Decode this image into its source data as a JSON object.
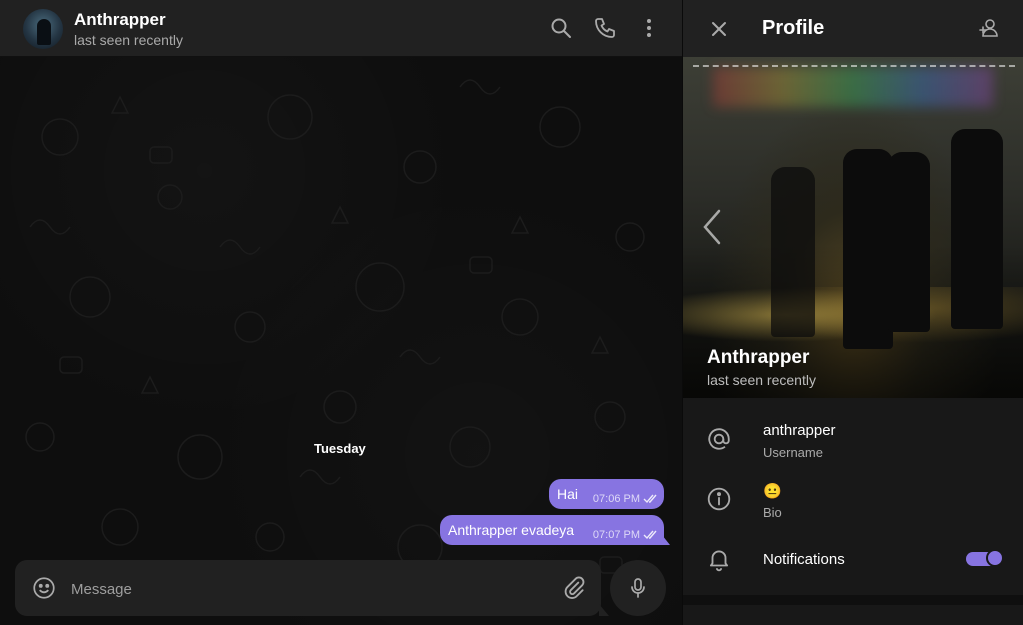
{
  "chat": {
    "title": "Anthrapper",
    "status": "last seen recently",
    "date_label": "Tuesday",
    "messages": [
      {
        "text": "Hai",
        "time": "07:06 PM",
        "outgoing": true,
        "read": true
      },
      {
        "text": "Anthrapper evadeya",
        "time": "07:07 PM",
        "outgoing": true,
        "read": true
      }
    ],
    "composer": {
      "placeholder": "Message"
    },
    "icons": {
      "search": "search-icon",
      "call": "phone-icon",
      "more": "more-vertical-icon",
      "emoji": "smile-icon",
      "attach": "paperclip-icon",
      "mic": "microphone-icon"
    }
  },
  "profile": {
    "header_title": "Profile",
    "name": "Anthrapper",
    "status": "last seen recently",
    "rows": {
      "username": {
        "value": "anthrapper",
        "label": "Username"
      },
      "bio": {
        "value": "😐",
        "label": "Bio"
      },
      "notifications": {
        "label": "Notifications",
        "enabled": true
      }
    },
    "icons": {
      "close": "close-icon",
      "add_contact": "add-contact-icon",
      "prev_photo": "chevron-left-icon",
      "at": "at-icon",
      "info": "info-icon",
      "bell": "bell-icon"
    }
  },
  "colors": {
    "accent": "#8774e1",
    "background": "#0e0e0e",
    "panel": "#212121",
    "profile_bg": "#181818",
    "secondary_text": "#aaaaaa"
  }
}
